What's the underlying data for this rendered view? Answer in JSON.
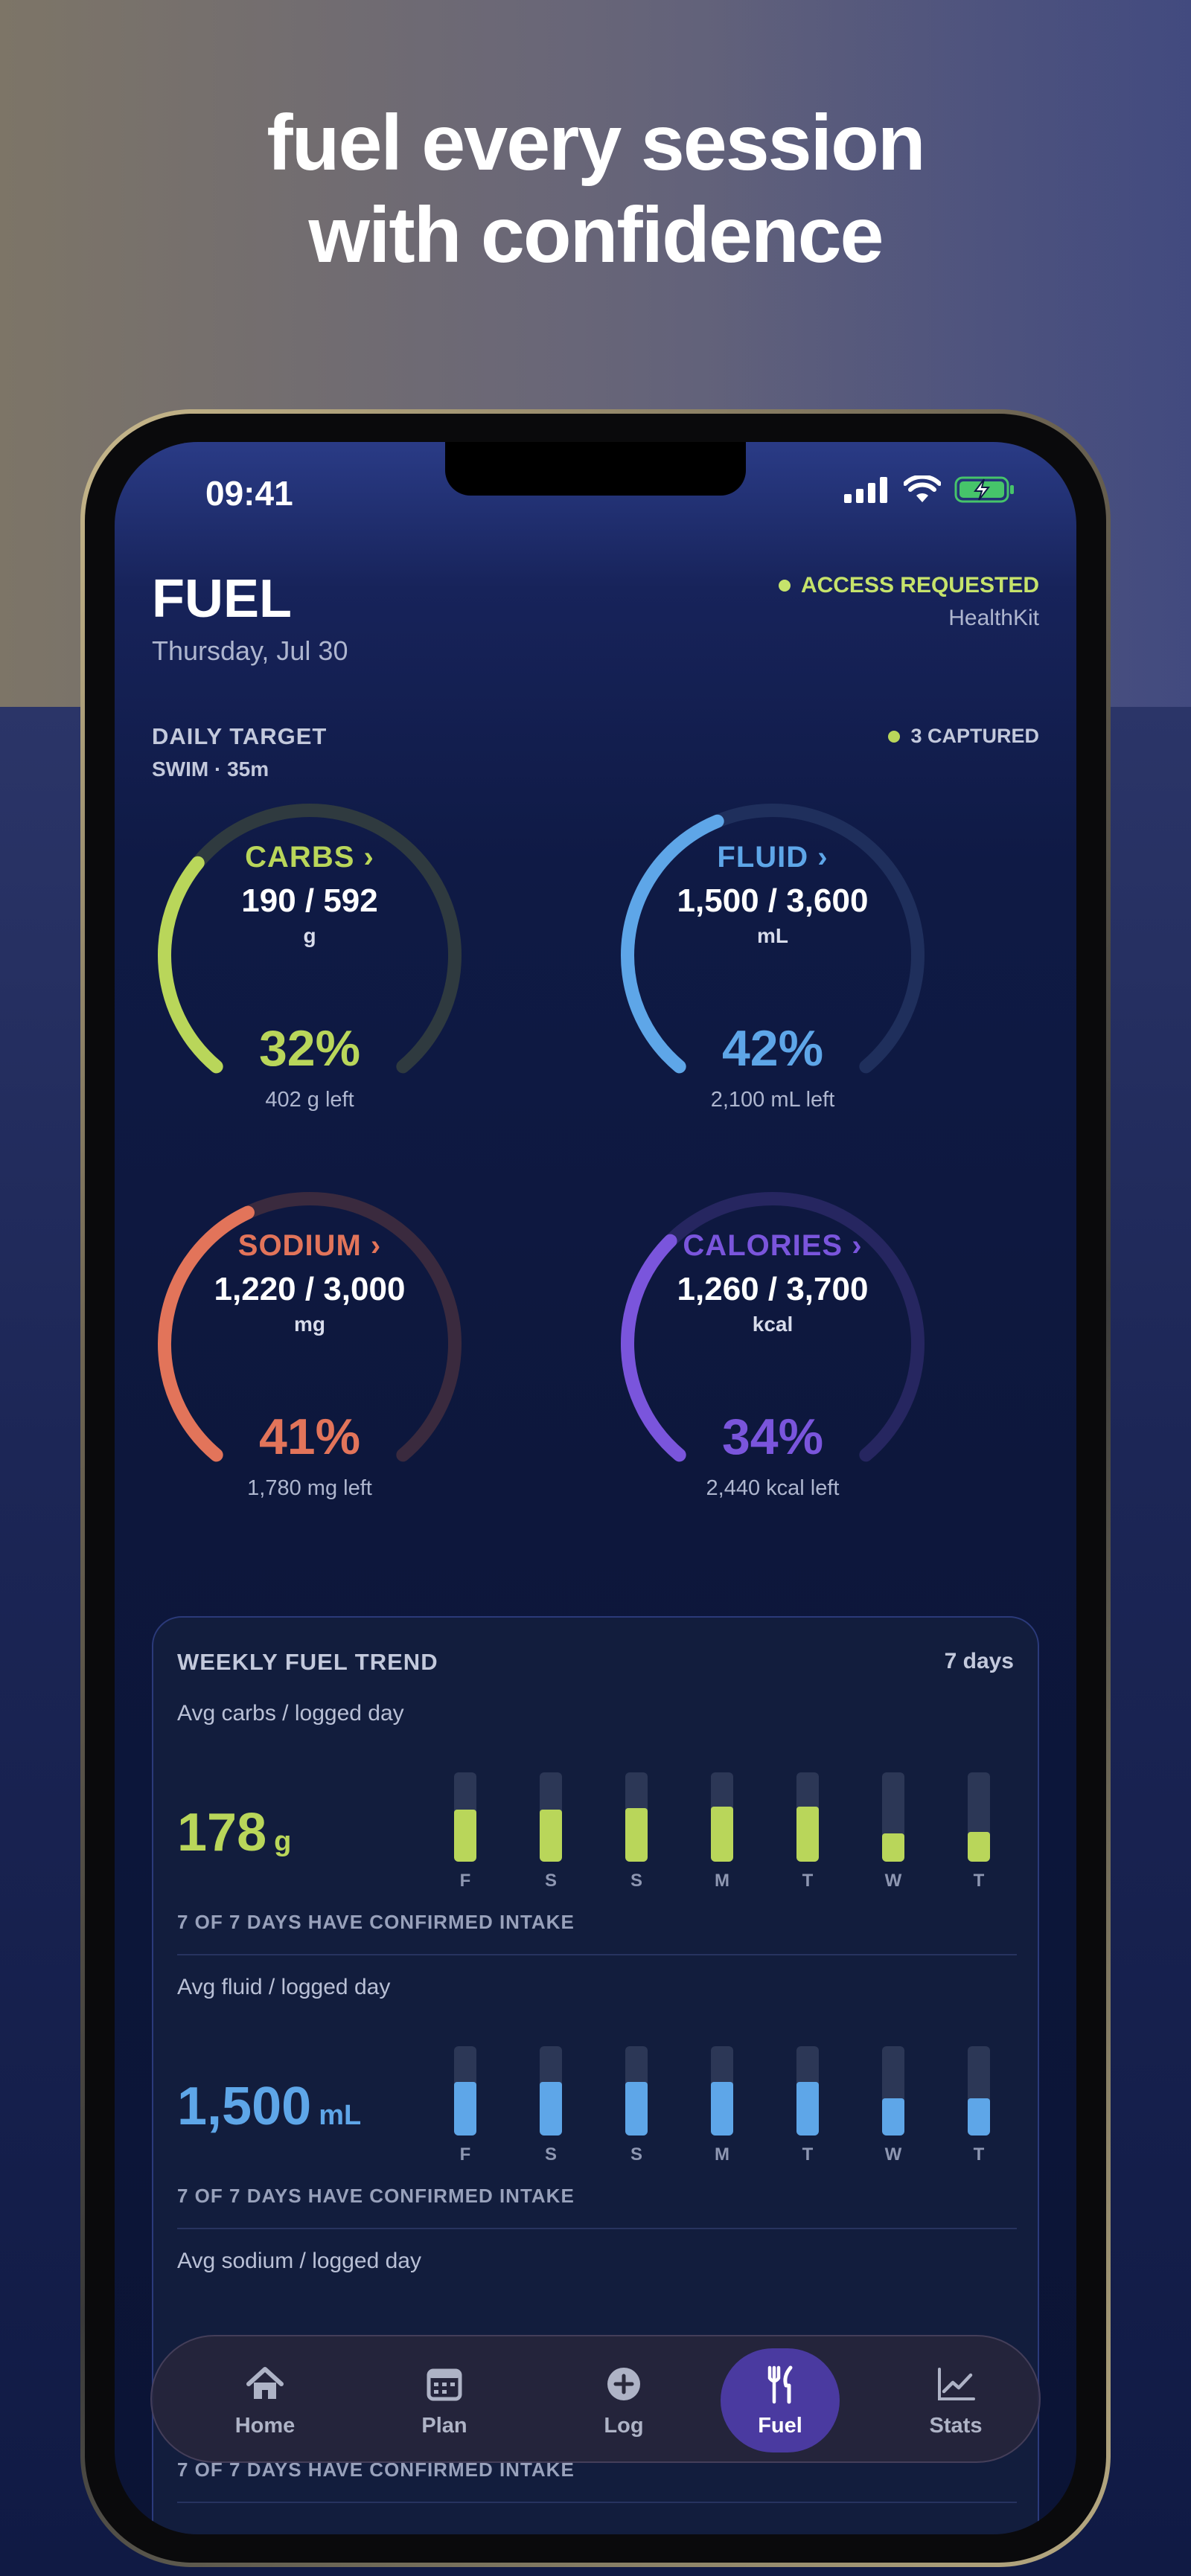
{
  "headline": {
    "line1": "fuel every session",
    "line2": "with confidence"
  },
  "status": {
    "time": "09:41"
  },
  "header": {
    "title": "FUEL",
    "date": "Thursday, Jul 30",
    "access_status": "ACCESS REQUESTED",
    "integration": "HealthKit"
  },
  "daily": {
    "label": "DAILY TARGET",
    "session": "SWIM · 35m",
    "captured": "3 CAPTURED"
  },
  "gauges": [
    {
      "label": "CARBS",
      "arrow": "›",
      "value": "190 / 592",
      "unit": "g",
      "pct": "32%",
      "left": "402 g left",
      "fraction": 0.32,
      "color": "#b9d65a",
      "track": "#2f3a3f"
    },
    {
      "label": "FLUID",
      "arrow": "›",
      "value": "1,500 / 3,600",
      "unit": "mL",
      "pct": "42%",
      "left": "2,100 mL left",
      "fraction": 0.42,
      "color": "#5ea6e8",
      "track": "#1f2f5c"
    },
    {
      "label": "SODIUM",
      "arrow": "›",
      "value": "1,220 / 3,000",
      "unit": "mg",
      "pct": "41%",
      "left": "1,780 mg left",
      "fraction": 0.41,
      "color": "#e2745a",
      "track": "#3a2a3e"
    },
    {
      "label": "CALORIES",
      "arrow": "›",
      "value": "1,260 / 3,700",
      "unit": "kcal",
      "pct": "34%",
      "left": "2,440 kcal left",
      "fraction": 0.34,
      "color": "#7a55dc",
      "track": "#262660"
    }
  ],
  "weekly": {
    "title": "WEEKLY FUEL TREND",
    "range": "7 days",
    "trends": [
      {
        "subtitle": "Avg carbs / logged day",
        "value": "178",
        "unit": "g",
        "footer": "7 OF 7 DAYS HAVE CONFIRMED INTAKE",
        "color": "#b9d65a",
        "days": [
          "F",
          "S",
          "S",
          "M",
          "T",
          "W",
          "T"
        ],
        "levels": [
          0.58,
          0.58,
          0.6,
          0.62,
          0.62,
          0.32,
          0.33
        ]
      },
      {
        "subtitle": "Avg fluid / logged day",
        "value": "1,500",
        "unit": "mL",
        "footer": "7 OF 7 DAYS HAVE CONFIRMED INTAKE",
        "color": "#5ea6e8",
        "days": [
          "F",
          "S",
          "S",
          "M",
          "T",
          "W",
          "T"
        ],
        "levels": [
          0.6,
          0.6,
          0.6,
          0.6,
          0.6,
          0.42,
          0.42
        ]
      },
      {
        "subtitle": "Avg sodium / logged day",
        "value": "",
        "unit": "",
        "footer": "7 OF 7 DAYS HAVE CONFIRMED INTAKE",
        "color": "#e2745a",
        "days": [],
        "levels": []
      }
    ]
  },
  "tabs": [
    {
      "label": "Home",
      "icon": "home-icon"
    },
    {
      "label": "Plan",
      "icon": "calendar-icon"
    },
    {
      "label": "Log",
      "icon": "plus-circle-icon"
    },
    {
      "label": "Fuel",
      "icon": "fork-knife-icon",
      "active": true
    },
    {
      "label": "Stats",
      "icon": "chart-line-icon"
    }
  ],
  "colors": {
    "accent_green": "#c6e36b",
    "tab_active": "#4a3aa0"
  }
}
